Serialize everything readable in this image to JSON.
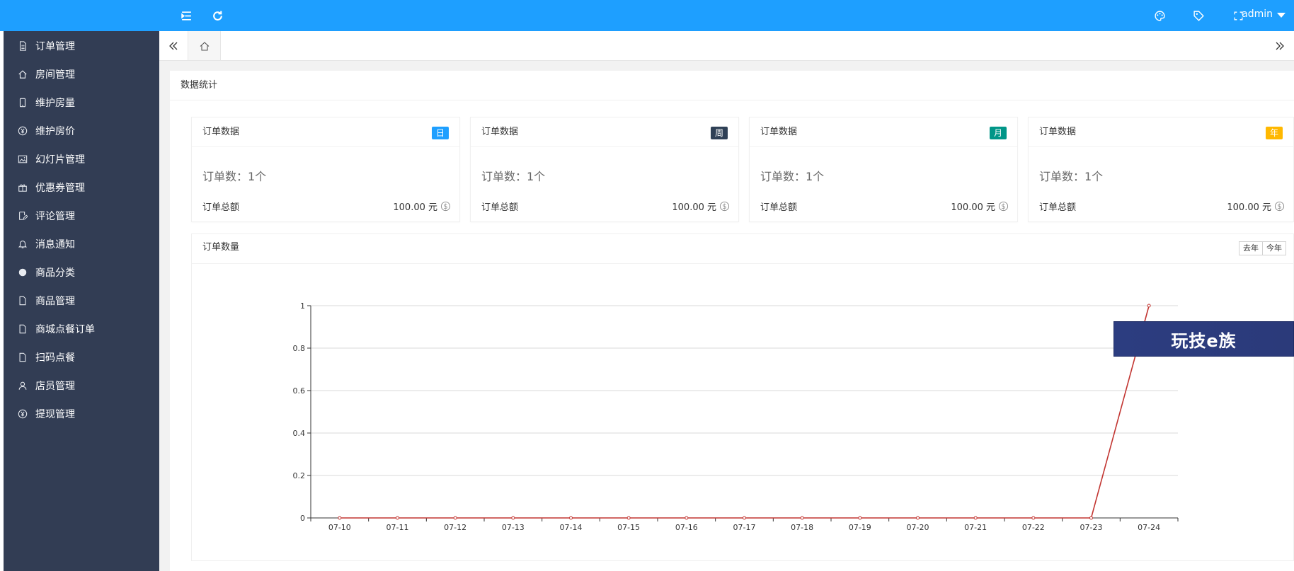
{
  "header": {
    "user": "admin"
  },
  "sidebar": {
    "items": [
      {
        "label": "订单管理",
        "icon": "document-icon"
      },
      {
        "label": "房间管理",
        "icon": "home-icon"
      },
      {
        "label": "维护房量",
        "icon": "tablet-icon"
      },
      {
        "label": "维护房价",
        "icon": "yen-circle-icon"
      },
      {
        "label": "幻灯片管理",
        "icon": "image-icon"
      },
      {
        "label": "优惠券管理",
        "icon": "gift-icon"
      },
      {
        "label": "评论管理",
        "icon": "edit-icon"
      },
      {
        "label": "消息通知",
        "icon": "bell-icon"
      },
      {
        "label": "商品分类",
        "icon": "circle-icon"
      },
      {
        "label": "商品管理",
        "icon": "file-icon"
      },
      {
        "label": "商城点餐订单",
        "icon": "file-icon"
      },
      {
        "label": "扫码点餐",
        "icon": "file-icon"
      },
      {
        "label": "店员管理",
        "icon": "user-icon"
      },
      {
        "label": "提现管理",
        "icon": "yen-circle-icon"
      }
    ]
  },
  "panel": {
    "title": "数据统计"
  },
  "cards": [
    {
      "title": "订单数据",
      "badge": "日",
      "badge_color": "#1e9fff",
      "count": "订单数：1个",
      "total_label": "订单总额",
      "total": "100.00 元"
    },
    {
      "title": "订单数据",
      "badge": "周",
      "badge_color": "#2f4056",
      "count": "订单数：1个",
      "total_label": "订单总额",
      "total": "100.00 元"
    },
    {
      "title": "订单数据",
      "badge": "月",
      "badge_color": "#009688",
      "count": "订单数：1个",
      "total_label": "订单总额",
      "total": "100.00 元"
    },
    {
      "title": "订单数据",
      "badge": "年",
      "badge_color": "#ffb800",
      "count": "订单数：1个",
      "total_label": "订单总额",
      "total": "100.00 元"
    }
  ],
  "chart_panel": {
    "title": "订单数量",
    "buttons": [
      "去年",
      "今年"
    ]
  },
  "watermark": "玩技e族",
  "chart_data": {
    "type": "line",
    "categories": [
      "07-10",
      "07-11",
      "07-12",
      "07-13",
      "07-14",
      "07-15",
      "07-16",
      "07-17",
      "07-18",
      "07-19",
      "07-20",
      "07-21",
      "07-22",
      "07-23",
      "07-24"
    ],
    "values": [
      0,
      0,
      0,
      0,
      0,
      0,
      0,
      0,
      0,
      0,
      0,
      0,
      0,
      0,
      1
    ],
    "ylim": [
      0,
      1
    ],
    "yticks": [
      "0",
      "0.2",
      "0.4",
      "0.6",
      "0.8",
      "1"
    ],
    "grid": true,
    "line_color": "#c23531"
  }
}
